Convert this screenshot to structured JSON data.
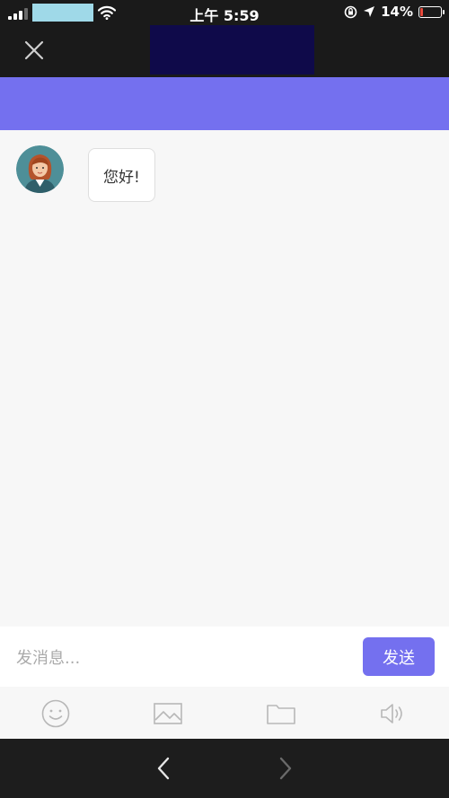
{
  "status_bar": {
    "time": "上午 5:59",
    "battery": "14%",
    "battery_level": 0.14
  },
  "chat": {
    "messages": [
      {
        "text": "您好!"
      }
    ]
  },
  "input": {
    "placeholder": "发消息...",
    "send_label": "发送"
  },
  "toolbar": {
    "icons": [
      "emoji-icon",
      "image-icon",
      "folder-icon",
      "speaker-icon"
    ]
  },
  "colors": {
    "accent": "#7470ef",
    "header": "#1a1a1a",
    "title_block": "#0f0a4a"
  }
}
